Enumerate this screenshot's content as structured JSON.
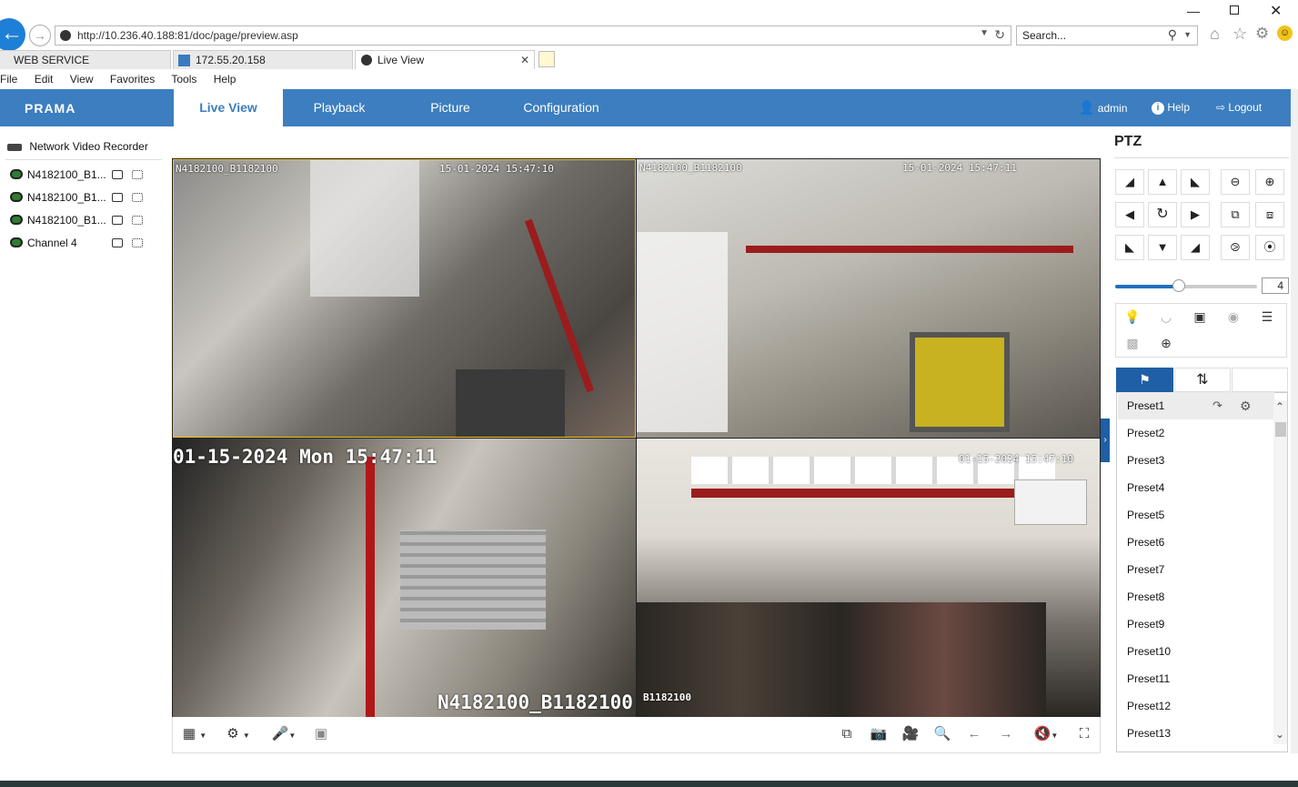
{
  "browser": {
    "url": "http://10.236.40.188:81/doc/page/preview.asp",
    "url_host": "10.236.40.188",
    "search_placeholder": "Search...",
    "tabs": [
      {
        "label": "WEB SERVICE"
      },
      {
        "label": "172.55.20.158"
      },
      {
        "label": "Live View"
      }
    ],
    "menu": [
      "File",
      "Edit",
      "View",
      "Favorites",
      "Tools",
      "Help"
    ]
  },
  "app": {
    "brand": "PRAMA",
    "nav": [
      "Live View",
      "Playback",
      "Picture",
      "Configuration"
    ],
    "user": "admin",
    "help": "Help",
    "logout": "Logout",
    "accent": "#3c7ebf"
  },
  "tree": {
    "root": "Network Video Recorder",
    "channels": [
      "N4182100_B1...",
      "N4182100_B1...",
      "N4182100_B1...",
      "Channel 4"
    ]
  },
  "videos": [
    {
      "name": "N4182100_B1182100",
      "time": "15-01-2024 15:47:10"
    },
    {
      "name": "N4182100_B1182100",
      "time": "15-01-2024 15:47:11"
    },
    {
      "time": "01-15-2024 Mon 15:47:11",
      "name": "N4182100_B1182100"
    },
    {
      "time": "01-15-2024 15:47:10",
      "name": "B1182100"
    }
  ],
  "ptz": {
    "title": "PTZ",
    "speed": "4",
    "speed_level": 0.45,
    "presets": [
      "Preset1",
      "Preset2",
      "Preset3",
      "Preset4",
      "Preset5",
      "Preset6",
      "Preset7",
      "Preset8",
      "Preset9",
      "Preset10",
      "Preset11",
      "Preset12",
      "Preset13"
    ]
  }
}
